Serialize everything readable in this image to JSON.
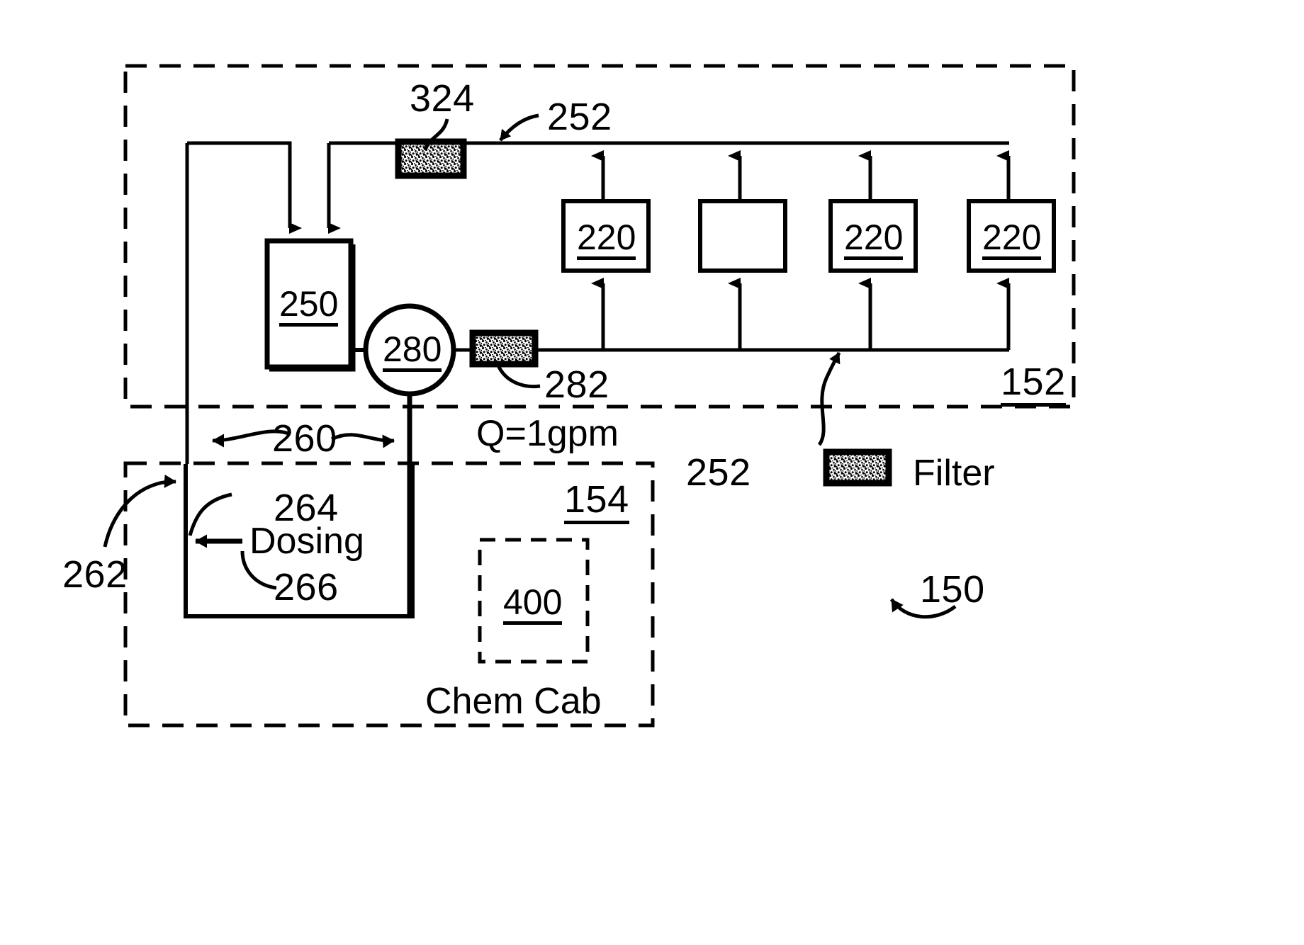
{
  "figure": {
    "type": "patent-schematic",
    "title": "Water treatment / dosing loop schematic",
    "background_color": "#ffffff",
    "line_color": "#000000"
  },
  "enclosures": [
    {
      "id": "152",
      "label": "152",
      "style": "dashed",
      "name": "upper-dashed-enclosure"
    },
    {
      "id": "154",
      "label": "154",
      "style": "dashed",
      "name": "lower-dashed-enclosure"
    },
    {
      "id": "400",
      "label": "400",
      "style": "dashed",
      "name": "chem-cab-inner-dashed-box"
    }
  ],
  "components": [
    {
      "id": "250",
      "label": "250",
      "shape": "rect",
      "name": "tank-250"
    },
    {
      "id": "280",
      "label": "280",
      "shape": "circle",
      "name": "pump-280"
    },
    {
      "id": "324",
      "label": "324",
      "shape": "filter-swatch",
      "name": "filter-324"
    },
    {
      "id": "282",
      "label": "282",
      "shape": "filter-swatch",
      "name": "filter-282"
    },
    {
      "id": "220a",
      "label": "220",
      "shape": "rect",
      "name": "unit-220-a"
    },
    {
      "id": "220b",
      "label": "",
      "shape": "rect",
      "name": "unit-blank-b"
    },
    {
      "id": "220c",
      "label": "220",
      "shape": "rect",
      "name": "unit-220-c"
    },
    {
      "id": "220d",
      "label": "220",
      "shape": "rect",
      "name": "unit-220-d"
    }
  ],
  "labels": {
    "ref_324": "324",
    "ref_252_top": "252",
    "ref_250": "250",
    "ref_280": "280",
    "ref_282": "282",
    "ref_152": "152",
    "ref_220_a": "220",
    "ref_220_c": "220",
    "ref_220_d": "220",
    "ref_260": "260",
    "ref_262": "262",
    "ref_264": "264",
    "ref_266": "266",
    "ref_252_mid": "252",
    "ref_154": "154",
    "ref_400": "400",
    "ref_150": "150",
    "flow_rate": "Q=1gpm",
    "dosing": "Dosing",
    "chem_cab": "Chem Cab",
    "legend_filter": "Filter"
  },
  "legend": {
    "items": [
      {
        "swatch": "filter-swatch",
        "label": "Filter"
      }
    ]
  }
}
